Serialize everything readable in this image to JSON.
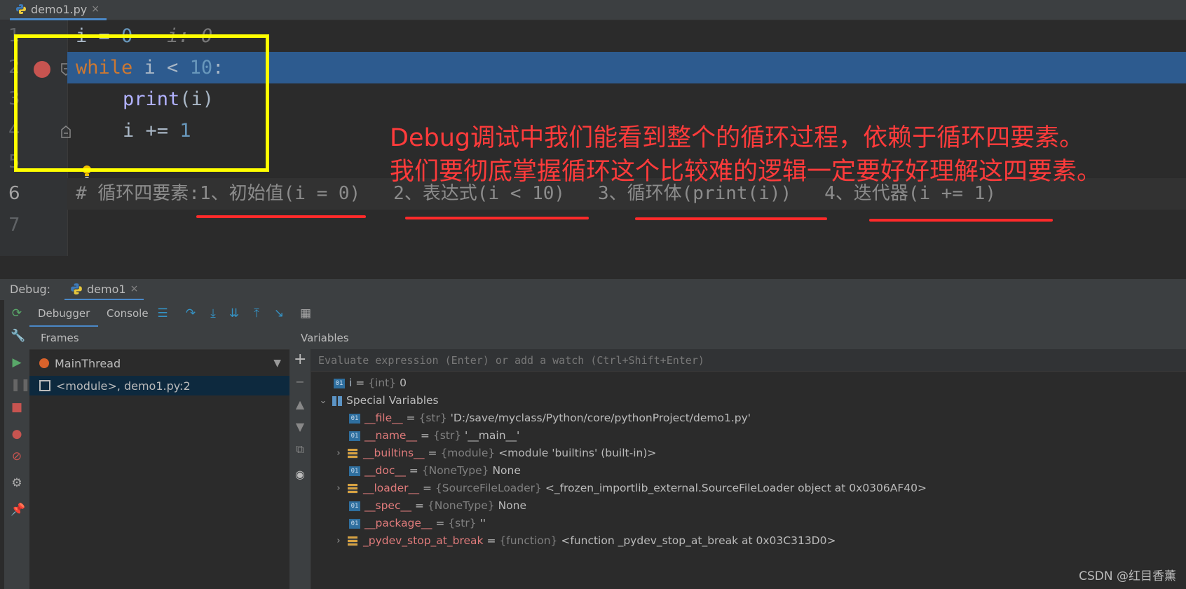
{
  "editor_tab": {
    "file_name": "demo1.py",
    "close": "×"
  },
  "code": {
    "line_numbers": [
      "1",
      "2",
      "3",
      "4",
      "5",
      "6",
      "7"
    ],
    "l1": {
      "var": "i",
      "op": " = ",
      "num": "0",
      "hint": "i: 0"
    },
    "l2": {
      "kw": "while",
      "rest": " i < ",
      "num": "10",
      "colon": ":"
    },
    "l3": {
      "fn": "print",
      "args": "(i)"
    },
    "l4": {
      "text": "i += ",
      "num": "1"
    },
    "l6": {
      "comment": "# 循环四要素:1、初始值(i = 0)   2、表达式(i < 10)   3、循环体(print(i))   4、迭代器(i += 1)"
    }
  },
  "annotation": {
    "line1": "Debug调试中我们能看到整个的循环过程，依赖于循环四要素。",
    "line2": "我们要彻底掌握循环这个比较难的逻辑一定要好好理解这四要素。"
  },
  "debug": {
    "label": "Debug:",
    "session_tab": "demo1",
    "close": "×",
    "tabs": {
      "debugger": "Debugger",
      "console": "Console"
    },
    "frames_header": "Frames",
    "thread": "MainThread",
    "frame": "<module>, demo1.py:2",
    "variables_header": "Variables",
    "eval_placeholder": "Evaluate expression (Enter) or add a watch (Ctrl+Shift+Enter)",
    "variables": [
      {
        "name": "i",
        "type": "{int}",
        "value": "0",
        "icon": "int-01-icon"
      },
      {
        "name": "Special Variables",
        "icon": "grid-icon",
        "expanded": true
      },
      {
        "name": "__file__",
        "type": "{str}",
        "value": "'D:/save/myclass/Python/core/pythonProject/demo1.py'",
        "icon": "int-01-icon"
      },
      {
        "name": "__name__",
        "type": "{str}",
        "value": "'__main__'",
        "icon": "int-01-icon"
      },
      {
        "name": "__builtins__",
        "type": "{module}",
        "value": "<module 'builtins' (built-in)>",
        "icon": "object-icon",
        "expandable": true
      },
      {
        "name": "__doc__",
        "type": "{NoneType}",
        "value": "None",
        "icon": "int-01-icon"
      },
      {
        "name": "__loader__",
        "type": "{SourceFileLoader}",
        "value": "<_frozen_importlib_external.SourceFileLoader object at 0x0306AF40>",
        "icon": "object-icon",
        "expandable": true
      },
      {
        "name": "__spec__",
        "type": "{NoneType}",
        "value": "None",
        "icon": "int-01-icon"
      },
      {
        "name": "__package__",
        "type": "{str}",
        "value": "''",
        "icon": "int-01-icon"
      },
      {
        "name": "_pydev_stop_at_break",
        "type": "{function}",
        "value": "<function _pydev_stop_at_break at 0x03C313D0>",
        "icon": "object-icon",
        "expandable": true
      }
    ]
  },
  "watermark": "CSDN @红目香薰",
  "colors": {
    "accent": "#4a88c7",
    "breakpoint": "#c75450",
    "annotation": "#ff3b3b",
    "highlight_box": "#ffff00",
    "current_line": "#2d5b8f"
  }
}
